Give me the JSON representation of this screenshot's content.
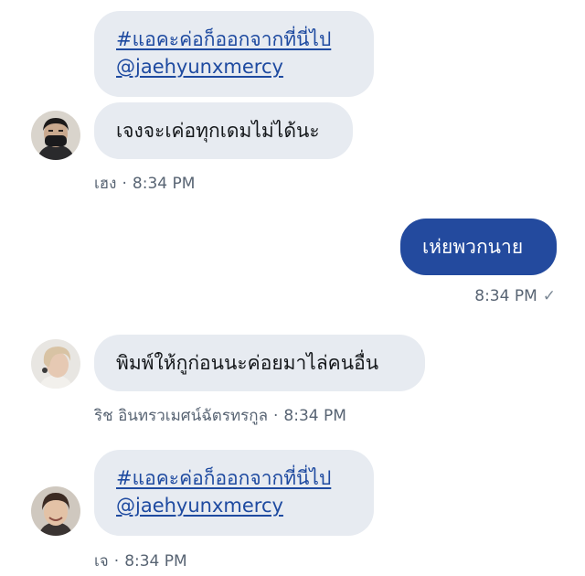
{
  "messages": [
    {
      "sender": "เฮง",
      "bubbles": [
        {
          "lines": [
            "#แอคะค่อก็ออกจากที่นี่ไป",
            "@jaehyunxmercy"
          ],
          "is_link": true
        },
        {
          "lines": [
            "เจงจะเค่อทุกเดมไม่ได้นะ"
          ],
          "is_link": false
        }
      ],
      "time": "8:34 PM"
    },
    {
      "sender": "me",
      "bubbles": [
        {
          "lines": [
            "เห่ยพวกนาย"
          ],
          "is_link": false
        }
      ],
      "time": "8:34 PM",
      "status_icon": "✓"
    },
    {
      "sender": "ริช อินทรวเมศน์ฉัตรทรกูล",
      "bubbles": [
        {
          "lines": [
            "พิมพ์ให้กูก่อนนะค่อยมาไล่คนอื่น"
          ],
          "is_link": false
        }
      ],
      "time": "8:34 PM"
    },
    {
      "sender": "เจ",
      "bubbles": [
        {
          "lines": [
            "#แอคะค่อก็ออกจากที่นี่ไป",
            "@jaehyunxmercy"
          ],
          "is_link": true
        }
      ],
      "time": "8:34 PM"
    }
  ],
  "separator": "·",
  "colors": {
    "incoming_bubble": "#e7ebf1",
    "outgoing_bubble": "#234a9e",
    "link": "#1e4aa0",
    "meta_text": "#586473"
  },
  "icons": {
    "avatar_1": "avatar-masked-man",
    "avatar_2": "avatar-blond-man",
    "avatar_3": "avatar-smiling-man",
    "sent_status": "check-icon"
  }
}
